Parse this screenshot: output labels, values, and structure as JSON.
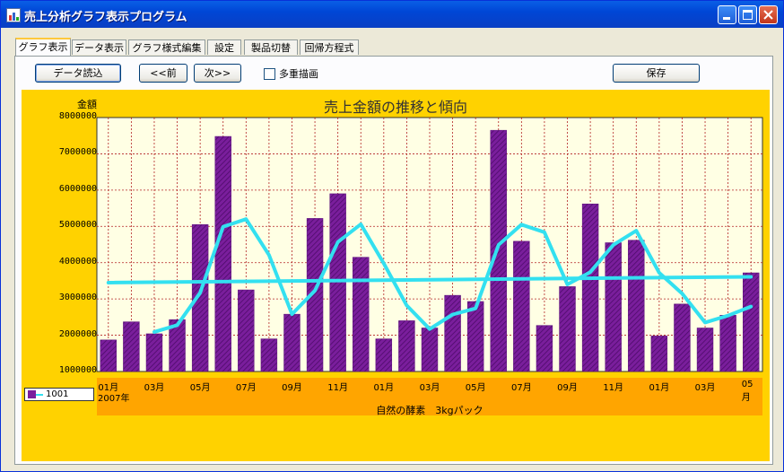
{
  "window": {
    "title": "売上分析グラフ表示プログラム"
  },
  "tabs": [
    "グラフ表示",
    "データ表示",
    "グラフ様式編集",
    "設定",
    "製品切替",
    "回帰方程式"
  ],
  "toolbar": {
    "load": "データ読込",
    "prev": "<<前",
    "next": "次>>",
    "multi": "多重描画",
    "save": "保存"
  },
  "icons": {
    "app": "chart-app-icon",
    "minimize": "minimize-icon",
    "maximize": "maximize-icon",
    "close": "close-icon"
  },
  "colors": {
    "chart_bg": "#FFD200",
    "plot_bg": "#FFFFE4",
    "bar": "#7A1E9C",
    "trend": "#33E0F0",
    "axis_band": "#FFA500"
  },
  "chart_data": {
    "type": "bar",
    "title": "売上金額の推移と傾向",
    "ylabel": "金額",
    "year_label": "2007年",
    "subtitle": "自然の酵素　3kgパック",
    "ylim": [
      1000000,
      8000000
    ],
    "yticks": [
      "8000000",
      "7000000",
      "6000000",
      "5000000",
      "4000000",
      "3000000",
      "2000000",
      "1000000"
    ],
    "xtick_labels": [
      "01月",
      "03月",
      "05月",
      "07月",
      "09月",
      "11月",
      "01月",
      "03月",
      "05月",
      "07月",
      "09月",
      "11月",
      "01月",
      "03月",
      "05月"
    ],
    "series": [
      {
        "name": "1001",
        "values": [
          1870000,
          2370000,
          2040000,
          2430000,
          5050000,
          7480000,
          3250000,
          1900000,
          2580000,
          5220000,
          5900000,
          4150000,
          1900000,
          2400000,
          2200000,
          3100000,
          2930000,
          7650000,
          4590000,
          2270000,
          3340000,
          5620000,
          4550000,
          4620000,
          1980000,
          2860000,
          2200000,
          2550000,
          3720000
        ]
      }
    ],
    "moving_average": [
      null,
      null,
      2090000,
      2280000,
      3170000,
      4990000,
      5200000,
      4210000,
      2580000,
      3230000,
      4570000,
      5060000,
      3980000,
      2820000,
      2170000,
      2570000,
      2740000,
      4490000,
      5050000,
      4840000,
      3400000,
      3740000,
      4490000,
      4880000,
      3720000,
      3150000,
      2350000,
      2540000,
      2790000
    ],
    "regression_line": [
      3450000,
      3610000
    ]
  }
}
